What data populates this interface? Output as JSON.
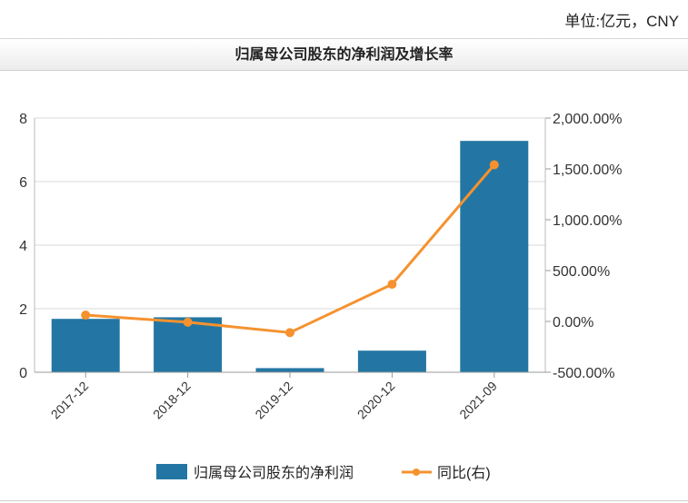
{
  "unit_label": "单位:亿元，CNY",
  "chart_data": {
    "type": "bar",
    "title": "归属母公司股东的净利润及增长率",
    "categories": [
      "2017-12",
      "2018-12",
      "2019-12",
      "2020-12",
      "2021-09"
    ],
    "series": [
      {
        "name": "归属母公司股东的净利润",
        "type": "bar",
        "axis": "left",
        "color": "#2376a3",
        "values": [
          1.68,
          1.73,
          0.13,
          0.68,
          7.28
        ]
      },
      {
        "name": "同比(右)",
        "type": "line",
        "axis": "right",
        "color": "#f5922f",
        "values": [
          62,
          -8,
          -110,
          365,
          1540
        ]
      }
    ],
    "y_left": {
      "min": 0,
      "max": 8,
      "ticks": [
        "0",
        "2",
        "4",
        "6",
        "8"
      ],
      "tick_values": [
        0,
        2,
        4,
        6,
        8
      ]
    },
    "y_right": {
      "min": -500,
      "max": 2000,
      "ticks": [
        "-500.00%",
        "0.00%",
        "500.00%",
        "1,000.00%",
        "1,500.00%",
        "2,000.00%"
      ],
      "tick_values": [
        -500,
        0,
        500,
        1000,
        1500,
        2000
      ]
    },
    "grid": true,
    "legend_position": "bottom"
  }
}
